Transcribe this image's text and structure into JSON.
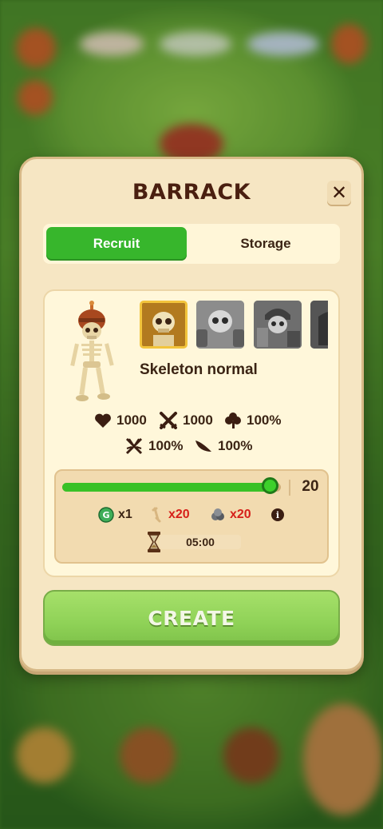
{
  "dialog": {
    "title": "BARRACK",
    "close_icon": "close-icon"
  },
  "tabs": [
    {
      "label": "Recruit",
      "selected": true
    },
    {
      "label": "Storage",
      "selected": false
    }
  ],
  "unit": {
    "name": "Skeleton normal",
    "portraits": [
      {
        "id": "skeleton-normal",
        "selected": true
      },
      {
        "id": "skeleton-shield",
        "selected": false
      },
      {
        "id": "skeleton-warrior",
        "selected": false
      },
      {
        "id": "skeleton-dark",
        "selected": false
      }
    ]
  },
  "stats": {
    "health": "1000",
    "attack": "1000",
    "luck": "100%",
    "special": "100%",
    "speed": "100%"
  },
  "recruit": {
    "quantity": "20",
    "slider_fraction": 0.95,
    "costs": [
      {
        "icon": "gem-icon",
        "value": "x1",
        "color": "#3b2414"
      },
      {
        "icon": "bone-icon",
        "value": "x20",
        "color": "#d6201a"
      },
      {
        "icon": "stone-icon",
        "value": "x20",
        "color": "#d6201a"
      }
    ],
    "info_icon": "i",
    "time": "05:00"
  },
  "actions": {
    "create_label": "CREATE"
  },
  "colors": {
    "accent_green": "#37b62c",
    "panel_bg": "#f6e6c3",
    "text_dark": "#3b2414",
    "cost_red": "#d6201a"
  }
}
